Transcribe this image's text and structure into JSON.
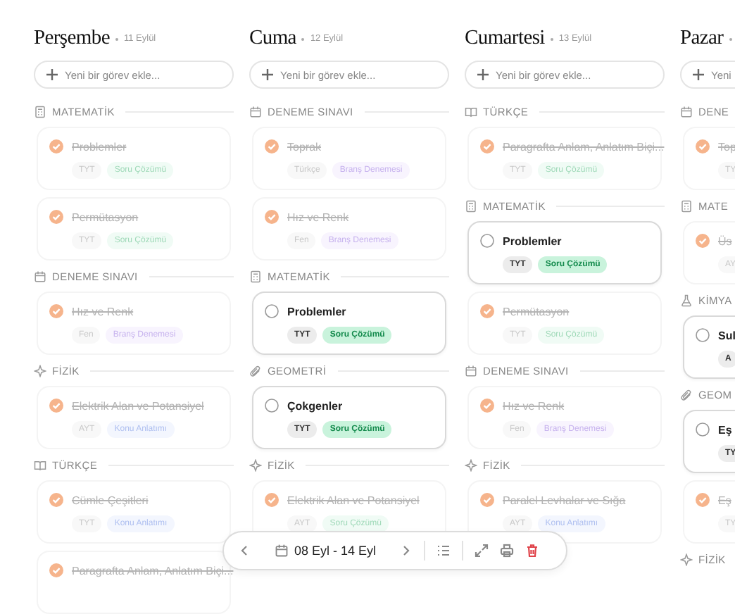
{
  "columns": [
    {
      "day": "Perşembe",
      "date": "11 Eylül",
      "placeholder": "Yeni bir görev ekle...",
      "sections": [
        {
          "title": "MATEMATİK",
          "kind": "calculator",
          "tasks": [
            {
              "title": "Problemler",
              "done": true,
              "tags": [
                {
                  "text": "TYT",
                  "kind": "level"
                },
                {
                  "text": "Soru Çözümü",
                  "kind": "practice"
                }
              ]
            },
            {
              "title": "Permütasyon",
              "done": true,
              "tags": [
                {
                  "text": "TYT",
                  "kind": "level"
                },
                {
                  "text": "Soru Çözümü",
                  "kind": "practice"
                }
              ]
            }
          ]
        },
        {
          "title": "DENEME SINAVI",
          "kind": "calendar",
          "tasks": [
            {
              "title": "Hız ve Renk",
              "done": true,
              "tags": [
                {
                  "text": "Fen",
                  "kind": "level"
                },
                {
                  "text": "Branş Denemesi",
                  "kind": "exam"
                }
              ]
            }
          ]
        },
        {
          "title": "FİZİK",
          "kind": "sparkle",
          "tasks": [
            {
              "title": "Elektrik Alan ve Potansiyel",
              "done": true,
              "tags": [
                {
                  "text": "AYT",
                  "kind": "level"
                },
                {
                  "text": "Konu Anlatımı",
                  "kind": "lecture"
                }
              ]
            }
          ]
        },
        {
          "title": "TÜRKÇE",
          "kind": "book",
          "tasks": [
            {
              "title": "Cümle Çeşitleri",
              "done": true,
              "tags": [
                {
                  "text": "TYT",
                  "kind": "level"
                },
                {
                  "text": "Konu Anlatımı",
                  "kind": "lecture"
                }
              ]
            },
            {
              "title": "Paragrafta Anlam, Anlatım Biçi...",
              "done": true
            }
          ]
        }
      ]
    },
    {
      "day": "Cuma",
      "date": "12 Eylül",
      "placeholder": "Yeni bir görev ekle...",
      "sections": [
        {
          "title": "DENEME SINAVI",
          "kind": "calendar",
          "tasks": [
            {
              "title": "Toprak",
              "done": true,
              "tags": [
                {
                  "text": "Türkçe",
                  "kind": "level"
                },
                {
                  "text": "Branş Denemesi",
                  "kind": "exam"
                }
              ]
            },
            {
              "title": "Hız ve Renk",
              "done": true,
              "tags": [
                {
                  "text": "Fen",
                  "kind": "level"
                },
                {
                  "text": "Branş Denemesi",
                  "kind": "exam"
                }
              ]
            }
          ]
        },
        {
          "title": "MATEMATİK",
          "kind": "calculator",
          "tasks": [
            {
              "title": "Problemler",
              "done": false,
              "tags": [
                {
                  "text": "TYT",
                  "kind": "level"
                },
                {
                  "text": "Soru Çözümü",
                  "kind": "practice"
                }
              ]
            }
          ]
        },
        {
          "title": "GEOMETRİ",
          "kind": "clip",
          "tasks": [
            {
              "title": "Çokgenler",
              "done": false,
              "tags": [
                {
                  "text": "TYT",
                  "kind": "level"
                },
                {
                  "text": "Soru Çözümü",
                  "kind": "practice"
                }
              ]
            }
          ]
        },
        {
          "title": "FİZİK",
          "kind": "sparkle",
          "tasks": [
            {
              "title": "Elektrik Alan ve Potansiyel",
              "done": true,
              "tags": [
                {
                  "text": "AYT",
                  "kind": "level"
                },
                {
                  "text": "Soru Çözümü",
                  "kind": "practice"
                }
              ]
            }
          ]
        }
      ]
    },
    {
      "day": "Cumartesi",
      "date": "13 Eylül",
      "placeholder": "Yeni bir görev ekle...",
      "sections": [
        {
          "title": "TÜRKÇE",
          "kind": "book",
          "tasks": [
            {
              "title": "Paragrafta Anlam, Anlatım Biçi...",
              "done": true,
              "tags": [
                {
                  "text": "TYT",
                  "kind": "level"
                },
                {
                  "text": "Soru Çözümü",
                  "kind": "practice"
                }
              ]
            }
          ]
        },
        {
          "title": "MATEMATİK",
          "kind": "calculator",
          "tasks": [
            {
              "title": "Problemler",
              "done": false,
              "tags": [
                {
                  "text": "TYT",
                  "kind": "level"
                },
                {
                  "text": "Soru Çözümü",
                  "kind": "practice"
                }
              ]
            },
            {
              "title": "Permütasyon",
              "done": true,
              "tags": [
                {
                  "text": "TYT",
                  "kind": "level"
                },
                {
                  "text": "Soru Çözümü",
                  "kind": "practice"
                }
              ]
            }
          ]
        },
        {
          "title": "DENEME SINAVI",
          "kind": "calendar",
          "tasks": [
            {
              "title": "Hız ve Renk",
              "done": true,
              "tags": [
                {
                  "text": "Fen",
                  "kind": "level"
                },
                {
                  "text": "Branş Denemesi",
                  "kind": "exam"
                }
              ]
            }
          ]
        },
        {
          "title": "FİZİK",
          "kind": "sparkle",
          "tasks": [
            {
              "title": "Paralel Levhalar ve Sığa",
              "done": true,
              "tags": [
                {
                  "text": "AYT",
                  "kind": "level"
                },
                {
                  "text": "Konu Anlatımı",
                  "kind": "lecture"
                }
              ]
            }
          ]
        }
      ]
    },
    {
      "day": "Pazar",
      "placeholder": "Yeni",
      "sections": [
        {
          "title": "DENE",
          "kind": "calendar",
          "tasks": [
            {
              "title": "Top",
              "done": true,
              "tags": [
                {
                  "text": "TY",
                  "kind": "level"
                }
              ]
            }
          ]
        },
        {
          "title": "MATE",
          "kind": "calculator",
          "tasks": [
            {
              "title": "Üs",
              "done": true,
              "tags": [
                {
                  "text": "AY",
                  "kind": "level"
                }
              ]
            }
          ]
        },
        {
          "title": "KİMYA",
          "kind": "flask",
          "tasks": [
            {
              "title": "Sul",
              "done": false,
              "tags": [
                {
                  "text": "A",
                  "kind": "level"
                }
              ]
            }
          ]
        },
        {
          "title": "GEOM",
          "kind": "clip",
          "tasks": [
            {
              "title": "Eş",
              "done": false,
              "tags": [
                {
                  "text": "TY",
                  "kind": "level"
                }
              ]
            },
            {
              "title": "Eş",
              "done": true,
              "tags": [
                {
                  "text": "TY",
                  "kind": "level"
                }
              ]
            }
          ]
        },
        {
          "title": "FİZİK",
          "kind": "sparkle"
        }
      ]
    }
  ],
  "toolbar": {
    "range": "08 Eyl - 14 Eyl"
  }
}
